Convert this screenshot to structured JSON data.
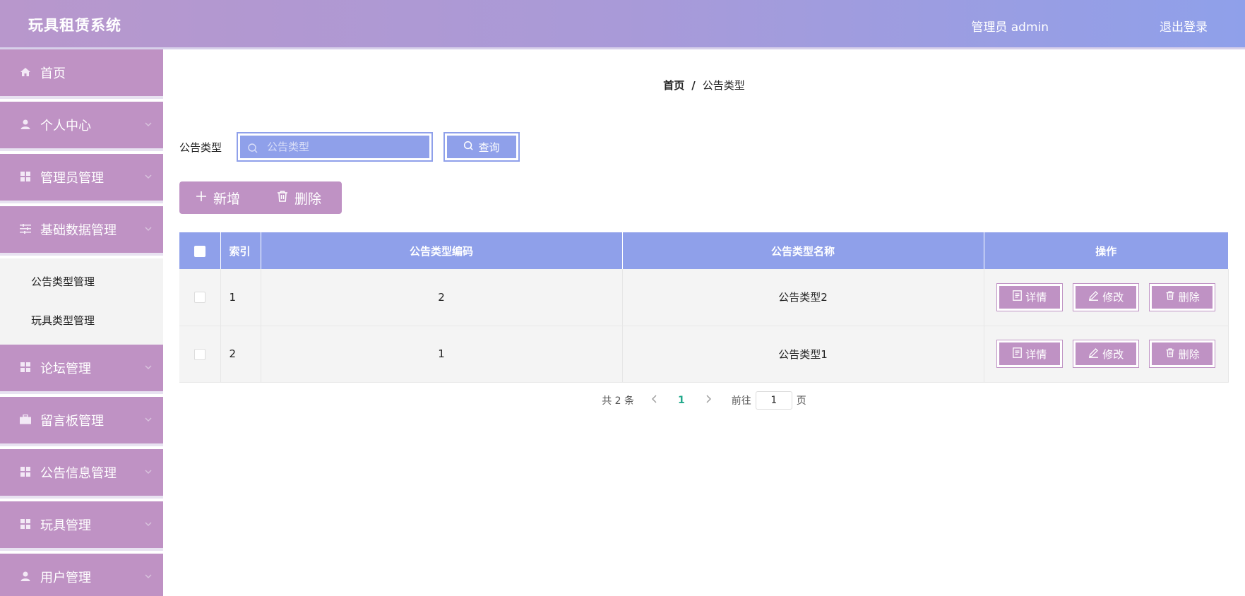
{
  "header": {
    "app_title": "玩具租赁系统",
    "user_label": "管理员 admin",
    "logout_label": "退出登录"
  },
  "sidebar": {
    "items": [
      {
        "label": "首页",
        "icon": "home-icon",
        "has_chevron": false
      },
      {
        "label": "个人中心",
        "icon": "user-icon",
        "has_chevron": true
      },
      {
        "label": "管理员管理",
        "icon": "grid-icon",
        "has_chevron": true
      },
      {
        "label": "基础数据管理",
        "icon": "sliders-icon",
        "has_chevron": true,
        "expanded": true,
        "children": [
          {
            "label": "公告类型管理"
          },
          {
            "label": "玩具类型管理"
          }
        ]
      },
      {
        "label": "论坛管理",
        "icon": "grid-icon",
        "has_chevron": true
      },
      {
        "label": "留言板管理",
        "icon": "briefcase-icon",
        "has_chevron": true
      },
      {
        "label": "公告信息管理",
        "icon": "grid-icon",
        "has_chevron": true
      },
      {
        "label": "玩具管理",
        "icon": "grid-icon",
        "has_chevron": true
      },
      {
        "label": "用户管理",
        "icon": "user-icon",
        "has_chevron": true
      }
    ]
  },
  "breadcrumb": {
    "home": "首页",
    "separator": "/",
    "current": "公告类型"
  },
  "search": {
    "label": "公告类型",
    "placeholder": "公告类型",
    "value": "",
    "query_label": "查询"
  },
  "actions": {
    "add_label": "新增",
    "delete_label": "删除"
  },
  "table": {
    "columns": [
      "索引",
      "公告类型编码",
      "公告类型名称",
      "操作"
    ],
    "rows": [
      {
        "index": "1",
        "code": "2",
        "name": "公告类型2"
      },
      {
        "index": "2",
        "code": "1",
        "name": "公告类型1"
      }
    ],
    "row_actions": {
      "detail": "详情",
      "edit": "修改",
      "delete": "删除"
    }
  },
  "pagination": {
    "total": "共 2 条",
    "current_page": "1",
    "goto_label": "前往",
    "goto_value": "1",
    "page_unit": "页"
  },
  "colors": {
    "header_gradient_start": "#b897cc",
    "header_gradient_end": "#8fa0ea",
    "sidebar_item": "#bf92c4",
    "accent_blue": "#8fa0ea",
    "action_purple": "#bf92c4",
    "active_page": "#21a98b"
  }
}
